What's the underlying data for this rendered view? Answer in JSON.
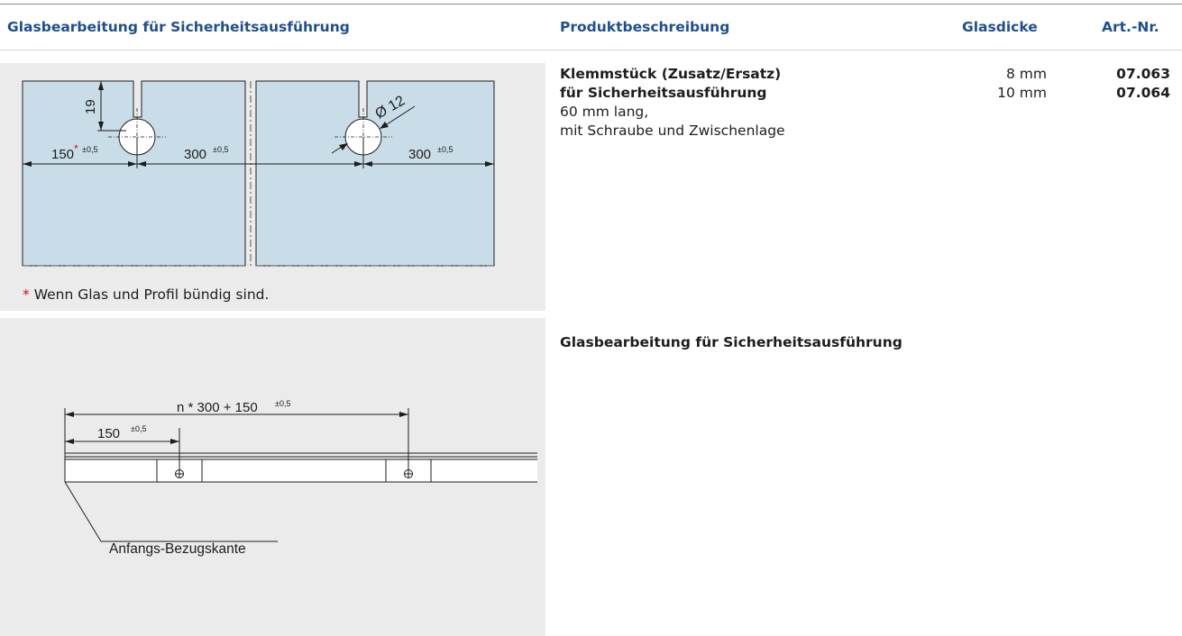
{
  "header": {
    "col1": "Glasbearbeitung für Sicherheitsausführung",
    "col2": "Produktbeschreibung",
    "col3": "Glasdicke",
    "col4": "Art.-Nr."
  },
  "product": {
    "name_line1": "Klemmstück (Zusatz/Ersatz)",
    "name_line2": "für Sicherheitsausführung",
    "detail_line1": "60 mm lang,",
    "detail_line2": "mit Schraube und Zwischenlage",
    "variants": [
      {
        "thickness": "8 mm",
        "art_nr": "07.063"
      },
      {
        "thickness": "10 mm",
        "art_nr": "07.064"
      }
    ]
  },
  "drawing1": {
    "dim_19": "19",
    "dim_150": "150",
    "tol": "±0,5",
    "dim_300a": "300",
    "dim_300b": "300",
    "dia": "Ø 12",
    "star": "*",
    "note": "Wenn Glas und Profil bündig sind."
  },
  "drawing2": {
    "dim_total": "n * 300 + 150",
    "dim_150": "150",
    "tol": "±0,5",
    "ref_label": "Anfangs-Bezugskante"
  },
  "section2_title": "Glasbearbeitung für Sicherheitsausführung",
  "colors": {
    "header_text": "#1f4f8f",
    "glass_fill": "#c9dde9",
    "panel_bg": "#ebebeb",
    "asterisk": "#e30613"
  }
}
